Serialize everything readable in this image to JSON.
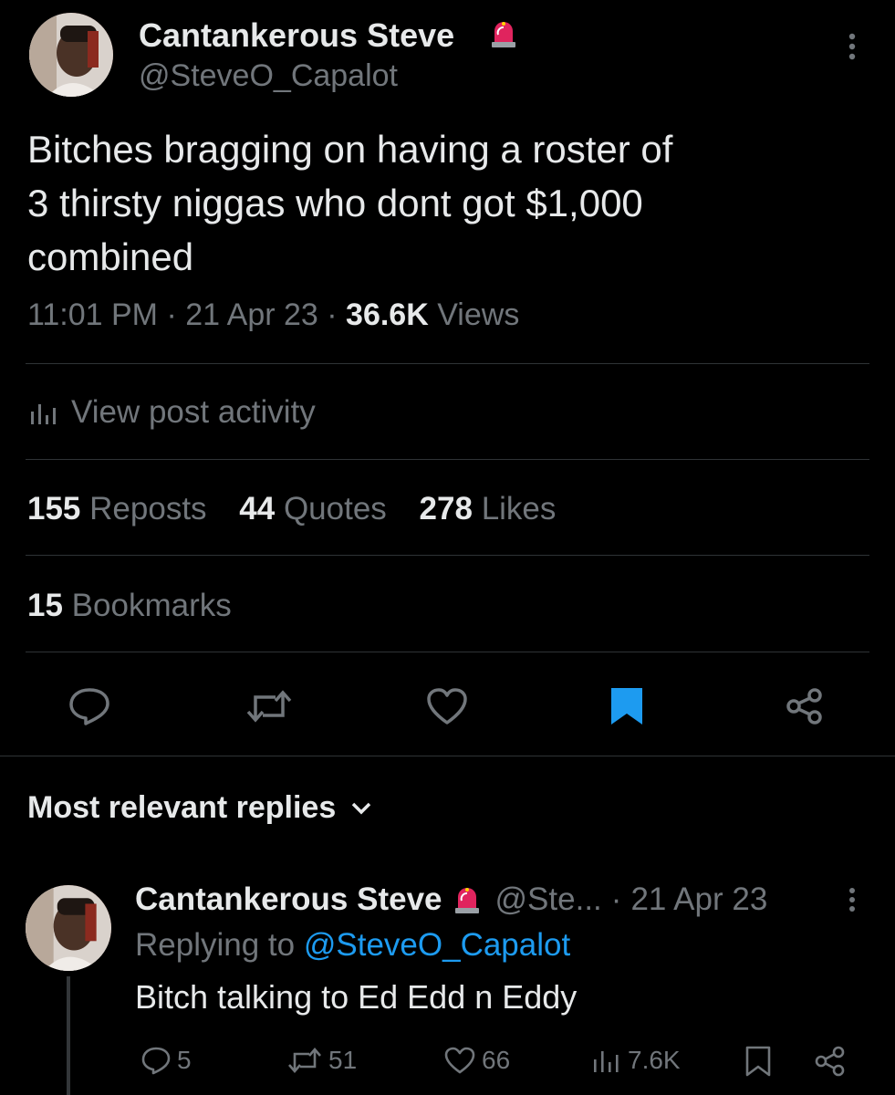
{
  "tweet": {
    "author_name": "Cantankerous Steve",
    "author_handle": "@SteveO_Capalot",
    "badge_icon": "police-siren-emoji",
    "text_line1": "Bitches bragging on having a roster of",
    "text_line2": "3 thirsty niggas who dont got $1,000",
    "text_line3": "combined",
    "time": "11:01 PM",
    "sep": "·",
    "date": "21 Apr 23",
    "views_count": "36.6K",
    "views_label": "Views",
    "activity_label": "View post activity",
    "reposts_count": "155",
    "reposts_label": "Reposts",
    "quotes_count": "44",
    "quotes_label": "Quotes",
    "likes_count": "278",
    "likes_label": "Likes",
    "bookmarks_count": "15",
    "bookmarks_label": "Bookmarks",
    "bookmark_color": "#1d9bf0"
  },
  "replies_header": {
    "label": "Most relevant replies"
  },
  "reply": {
    "author_name": "Cantankerous Steve",
    "handle_truncated": "@Ste...",
    "sep": "·",
    "date": "21 Apr 23",
    "replying_label": "Replying to",
    "replying_handle": "@SteveO_Capalot",
    "text": "Bitch talking to Ed Edd n Eddy",
    "replies_count": "5",
    "reposts_count": "51",
    "likes_count": "66",
    "views_count": "7.6K"
  },
  "colors": {
    "background": "#000000",
    "text": "#e7e9ea",
    "muted": "#71767b",
    "accent": "#1d9bf0",
    "divider": "#2f3336"
  }
}
